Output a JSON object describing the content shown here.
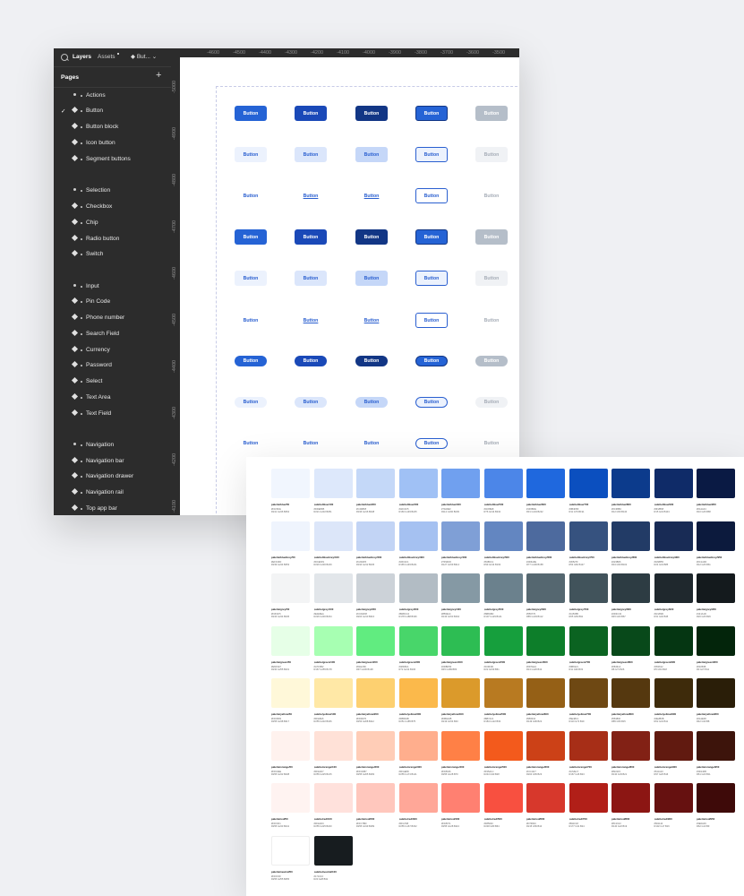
{
  "sidebar": {
    "tabs": {
      "layers": "Layers",
      "assets": "Assets",
      "current_page": "But..."
    },
    "pages_title": "Pages",
    "add_label": "+",
    "pages": [
      {
        "label": "Actions",
        "kind": "section"
      },
      {
        "label": "Button",
        "kind": "component",
        "checked": true
      },
      {
        "label": "Button block",
        "kind": "component"
      },
      {
        "label": "Icon button",
        "kind": "component"
      },
      {
        "label": "Segment buttons",
        "kind": "component"
      },
      {
        "label": "Selection",
        "kind": "section"
      },
      {
        "label": "Checkbox",
        "kind": "component"
      },
      {
        "label": "Chip",
        "kind": "component"
      },
      {
        "label": "Radio button",
        "kind": "component"
      },
      {
        "label": "Switch",
        "kind": "component"
      },
      {
        "label": "Input",
        "kind": "section"
      },
      {
        "label": "Pin Code",
        "kind": "component"
      },
      {
        "label": "Phone number",
        "kind": "component"
      },
      {
        "label": "Search Field",
        "kind": "component"
      },
      {
        "label": "Currency",
        "kind": "component"
      },
      {
        "label": "Password",
        "kind": "component"
      },
      {
        "label": "Select",
        "kind": "component"
      },
      {
        "label": "Text Area",
        "kind": "component"
      },
      {
        "label": "Text Field",
        "kind": "component"
      },
      {
        "label": "Navigation",
        "kind": "section"
      },
      {
        "label": "Navigation bar",
        "kind": "component"
      },
      {
        "label": "Navigation drawer",
        "kind": "component"
      },
      {
        "label": "Navigation rail",
        "kind": "component"
      },
      {
        "label": "Top app bar",
        "kind": "component"
      }
    ]
  },
  "rulers": {
    "top": [
      "-4600",
      "-4500",
      "-4400",
      "-4300",
      "-4200",
      "-4100",
      "-4000",
      "-3900",
      "-3800",
      "-3700",
      "-3600",
      "-3500"
    ],
    "left": [
      "-5000",
      "-4900",
      "-4800",
      "-4700",
      "-4600",
      "-4500",
      "-4400",
      "-4300",
      "-4200",
      "-4100"
    ]
  },
  "canvas": {
    "button_label": "Button",
    "rows": [
      [
        "fill1",
        "fill2",
        "fill3",
        "fill4",
        "dis"
      ],
      [
        "ton1",
        "ton2",
        "ton3",
        "ton4",
        "tdis"
      ],
      [
        "txt",
        "txtu",
        "txtu",
        "txto",
        "txtd"
      ],
      [
        "fill1",
        "fill2",
        "fill3",
        "fill4",
        "dis"
      ],
      [
        "ton1",
        "ton2",
        "ton3",
        "ton4",
        "tdis"
      ],
      [
        "txt",
        "txtu",
        "txtu",
        "txto",
        "txtd"
      ],
      [
        "fill1",
        "fill2",
        "fill3",
        "fill4",
        "dis"
      ],
      [
        "ton1",
        "ton2",
        "ton3",
        "ton4",
        "tdis"
      ],
      [
        "txt",
        "txt",
        "txt",
        "txto",
        "txtd"
      ]
    ]
  },
  "palette": {
    "rows": [
      {
        "family": "blue",
        "colors": [
          "#f1f6fe",
          "#dde8fb",
          "#c4d8f8",
          "#a0c1f5",
          "#70a0ef",
          "#4c86e8",
          "#1f68de",
          "#0b4fbf",
          "#0c3b8c",
          "#0f2b68",
          "#0a1a44"
        ]
      },
      {
        "family": "blueGrey",
        "colors": [
          "#eff4fd",
          "#dce6f9",
          "#c2d4f5",
          "#a5c1f1",
          "#7f9fd6",
          "#6386c1",
          "#4d6a9e",
          "#36527f",
          "#223b66",
          "#182b55",
          "#0c1a3d"
        ]
      },
      {
        "family": "grey",
        "colors": [
          "#f3f4f5",
          "#e2e6ea",
          "#ccd2d8",
          "#b2bcc4",
          "#8599a4",
          "#6b818d",
          "#556770",
          "#41535b",
          "#2d3c43",
          "#1f282d",
          "#141a1d"
        ]
      },
      {
        "family": "green",
        "colors": [
          "#e6ffe7",
          "#a7ffb2",
          "#61ec80",
          "#48d66a",
          "#2dbd53",
          "#169f3d",
          "#0d7e2a",
          "#0b6321",
          "#08491a",
          "#053612",
          "#03250b"
        ]
      },
      {
        "family": "yellow",
        "colors": [
          "#fff8d9",
          "#ffe8a6",
          "#fdd070",
          "#fbb94b",
          "#db9a2b",
          "#b87a21",
          "#956016",
          "#6e4813",
          "#55380f",
          "#3e2b0b",
          "#2a1e08"
        ]
      },
      {
        "family": "orange",
        "colors": [
          "#fff2ee",
          "#ffe1d7",
          "#ffcdb7",
          "#ffae8d",
          "#ff8046",
          "#f35a1c",
          "#cc4117",
          "#a72e17",
          "#822115",
          "#611a10",
          "#3d140b"
        ]
      },
      {
        "family": "red",
        "colors": [
          "#fff3f1",
          "#ffe1dc",
          "#ffc7bd",
          "#ffa798",
          "#ff8071",
          "#f85040",
          "#d7382c",
          "#b11f18",
          "#8c1613",
          "#661110",
          "#3e0a09"
        ]
      },
      {
        "family": "neutral",
        "colors": [
          "#ffffff",
          "#171c1f"
        ]
      }
    ]
  }
}
